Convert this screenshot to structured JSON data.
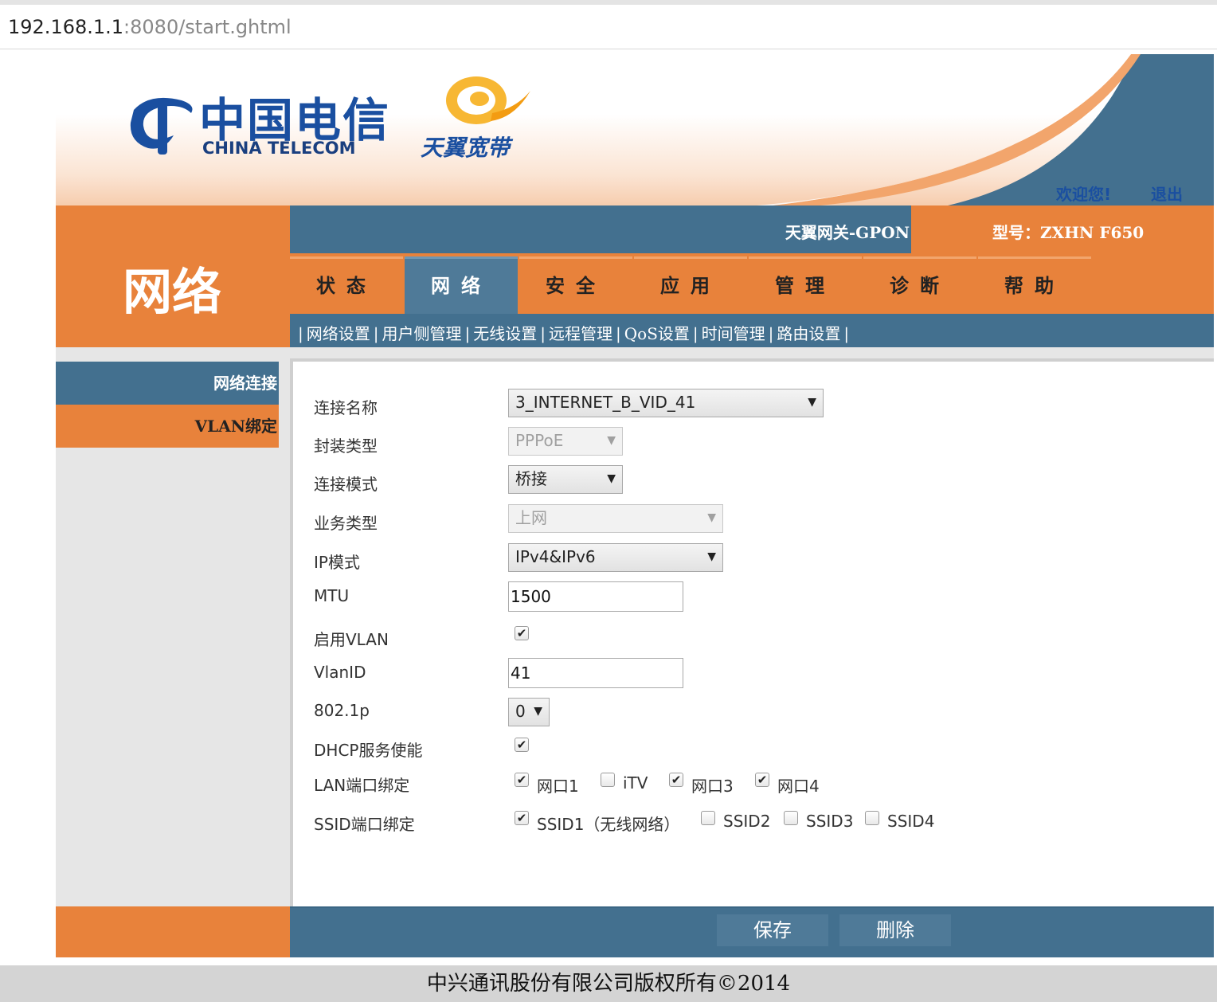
{
  "address_bar": {
    "host": "192.168.1.1",
    "path": ":8080/start.ghtml"
  },
  "header": {
    "brand_cn": "中国电信",
    "brand_en": "CHINA TELECOM",
    "product": "天翼宽带",
    "welcome": "欢迎您!",
    "logout": "退出",
    "gateway_title": "天翼网关-GPON",
    "model": "型号：ZXHN F650"
  },
  "section_title": "网络",
  "tabs": [
    {
      "label": "状态",
      "active": false
    },
    {
      "label": "网络",
      "active": true
    },
    {
      "label": "安全",
      "active": false
    },
    {
      "label": "应用",
      "active": false
    },
    {
      "label": "管理",
      "active": false
    },
    {
      "label": "诊断",
      "active": false
    },
    {
      "label": "帮助",
      "active": false
    }
  ],
  "subnav": [
    "网络设置",
    "用户侧管理",
    "无线设置",
    "远程管理",
    "QoS设置",
    "时间管理",
    "路由设置"
  ],
  "sidebar": {
    "items": [
      "网络连接",
      "VLAN绑定"
    ]
  },
  "form": {
    "connection_name": {
      "label": "连接名称",
      "value": "3_INTERNET_B_VID_41"
    },
    "encap_type": {
      "label": "封装类型",
      "value": "PPPoE"
    },
    "conn_mode": {
      "label": "连接模式",
      "value": "桥接"
    },
    "service_type": {
      "label": "业务类型",
      "value": "上网"
    },
    "ip_mode": {
      "label": "IP模式",
      "value": "IPv4&IPv6"
    },
    "mtu": {
      "label": "MTU",
      "value": "1500"
    },
    "enable_vlan": {
      "label": "启用VLAN",
      "checked": true
    },
    "vlan_id": {
      "label": "VlanID",
      "value": "41"
    },
    "dot1p": {
      "label": "802.1p",
      "value": "0"
    },
    "dhcp": {
      "label": "DHCP服务使能",
      "checked": true
    },
    "lan_bind": {
      "label": "LAN端口绑定",
      "ports": [
        {
          "label": "网口1",
          "checked": true
        },
        {
          "label": "iTV",
          "checked": false
        },
        {
          "label": "网口3",
          "checked": true
        },
        {
          "label": "网口4",
          "checked": true
        }
      ]
    },
    "ssid_bind": {
      "label": "SSID端口绑定",
      "ports": [
        {
          "label": "SSID1（无线网络）",
          "checked": true
        },
        {
          "label": "SSID2",
          "checked": false
        },
        {
          "label": "SSID3",
          "checked": false
        },
        {
          "label": "SSID4",
          "checked": false
        }
      ]
    }
  },
  "buttons": {
    "save": "保存",
    "delete": "删除"
  },
  "footer": "中兴通讯股份有限公司版权所有©2014",
  "colors": {
    "orange": "#e8823b",
    "blue": "#43708f",
    "brand_blue": "#1a4fa0"
  },
  "check_glyph": "✔"
}
